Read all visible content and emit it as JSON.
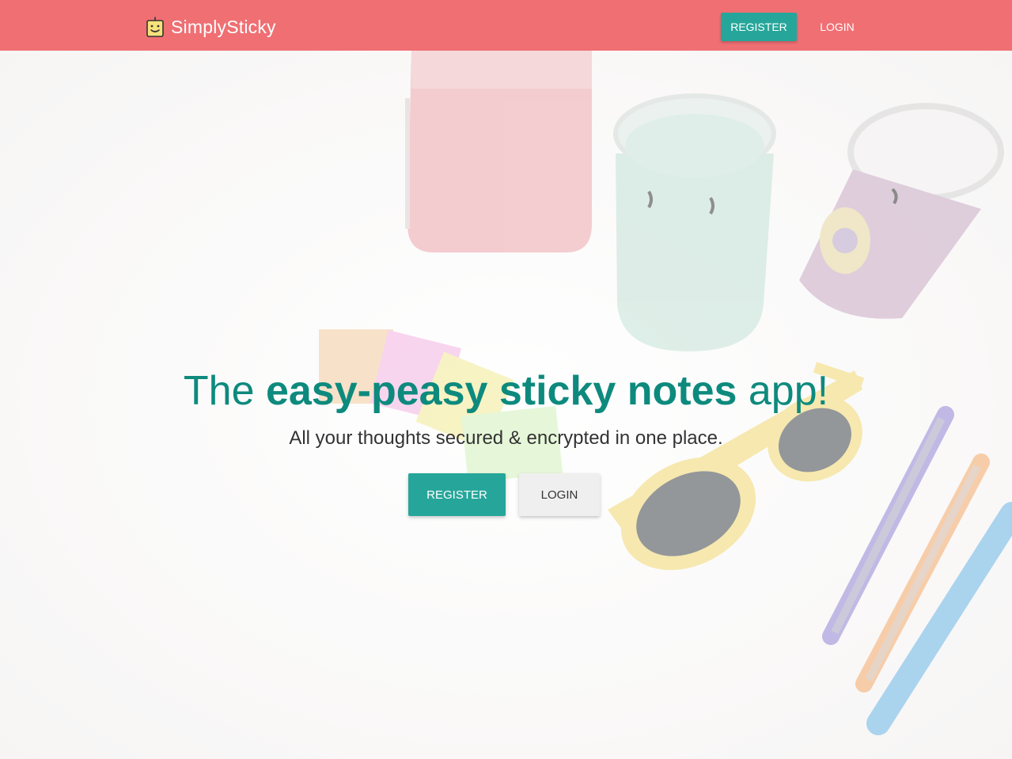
{
  "navbar": {
    "brand_name": "SimplySticky",
    "brand_icon": "smiley-sticky-note-icon",
    "register_label": "REGISTER",
    "login_label": "LOGIN"
  },
  "hero": {
    "title_part1": "The ",
    "title_bold": "easy-peasy sticky notes",
    "title_part2": " app!",
    "subtitle": "All your thoughts secured & encrypted in one place.",
    "register_label": "REGISTER",
    "login_label": "LOGIN",
    "background_image": "candle-jars-sticky-notes-sunglasses-pens-photo"
  },
  "colors": {
    "navbar_bg": "#ef6f73",
    "accent": "#26a69a",
    "title_text": "#0d8a7d",
    "secondary_button_bg": "#efefef"
  }
}
